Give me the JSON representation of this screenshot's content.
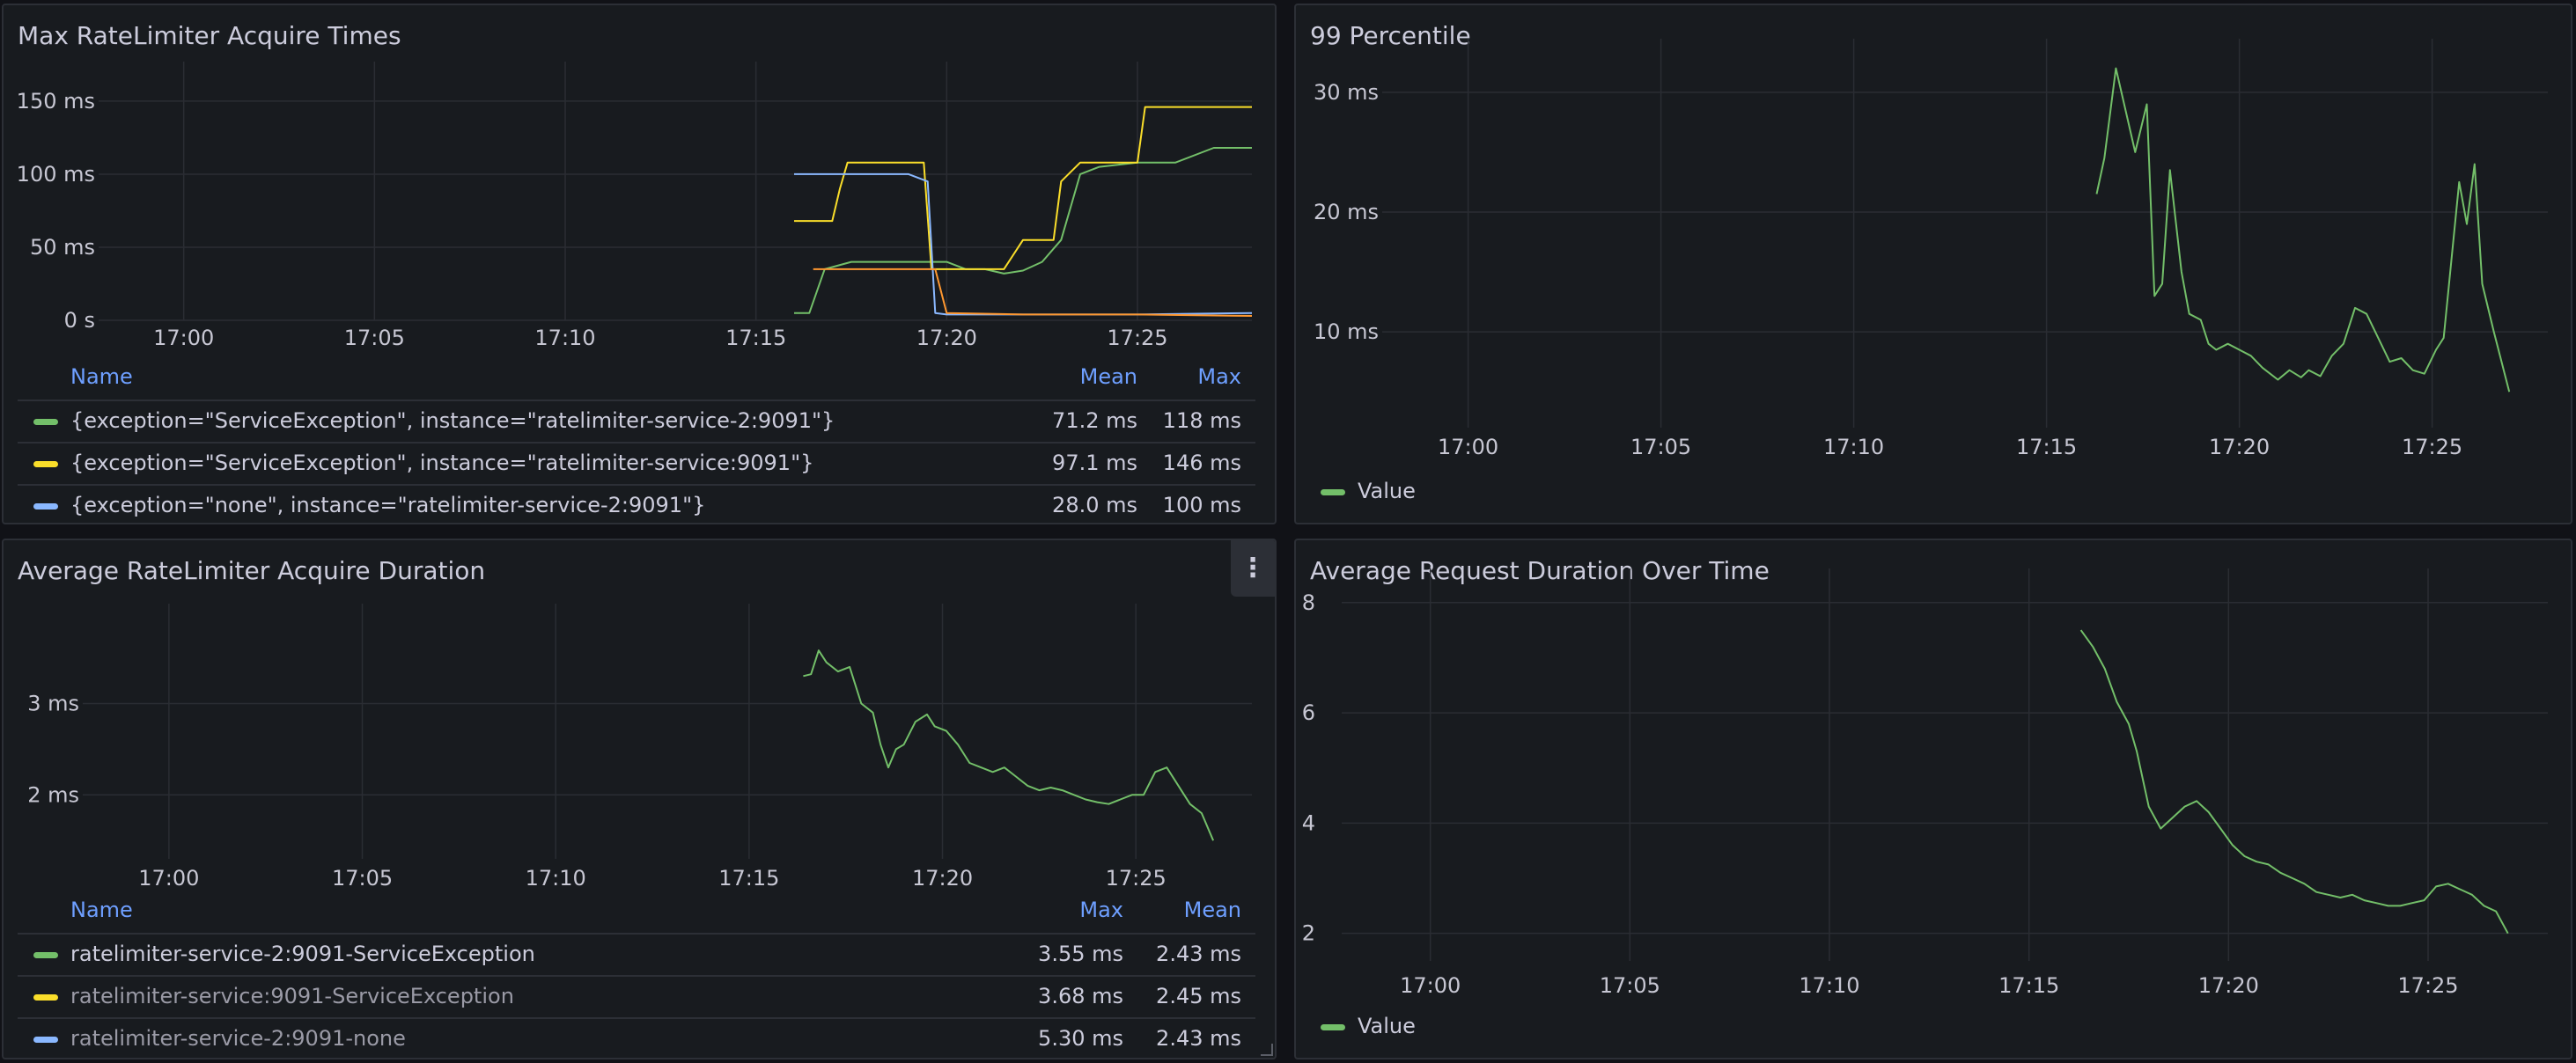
{
  "colors": {
    "green": "#73bf69",
    "yellow": "#fade2a",
    "blue": "#8ab8ff",
    "orange": "#ff9830"
  },
  "panels": {
    "max_acquire": {
      "title": "Max RateLimiter Acquire Times",
      "legend": {
        "headers": [
          "Name",
          "Mean",
          "Max"
        ],
        "rows": [
          {
            "name": "{exception=\"ServiceException\", instance=\"ratelimiter-service-2:9091\"}",
            "mean": "71.2 ms",
            "max": "118 ms",
            "color": "#73bf69"
          },
          {
            "name": "{exception=\"ServiceException\", instance=\"ratelimiter-service:9091\"}",
            "mean": "97.1 ms",
            "max": "146 ms",
            "color": "#fade2a"
          },
          {
            "name": "{exception=\"none\", instance=\"ratelimiter-service-2:9091\"}",
            "mean": "28.0 ms",
            "max": "100 ms",
            "color": "#8ab8ff"
          }
        ]
      }
    },
    "p99": {
      "title": "99 Percentile",
      "legend": {
        "label": "Value",
        "color": "#73bf69"
      }
    },
    "avg_acquire": {
      "title": "Average RateLimiter Acquire Duration",
      "menu_icon": "⋮",
      "legend": {
        "headers": [
          "Name",
          "Max",
          "Mean"
        ],
        "rows": [
          {
            "name": "ratelimiter-service-2:9091-ServiceException",
            "max": "3.55 ms",
            "mean": "2.43 ms",
            "color": "#73bf69"
          },
          {
            "name": "ratelimiter-service:9091-ServiceException",
            "max": "3.68 ms",
            "mean": "2.45 ms",
            "color": "#fade2a"
          },
          {
            "name": "ratelimiter-service-2:9091-none",
            "max": "5.30 ms",
            "mean": "2.43 ms",
            "color": "#8ab8ff"
          }
        ]
      }
    },
    "avg_request": {
      "title": "Average Request Duration Over Time",
      "legend": {
        "label": "Value",
        "color": "#73bf69"
      }
    }
  },
  "chart_data": [
    {
      "type": "line",
      "title": "Max RateLimiter Acquire Times",
      "x_ticks": [
        "17:00",
        "17:05",
        "17:10",
        "17:15",
        "17:20",
        "17:25"
      ],
      "y_ticks": [
        "0 s",
        "50 ms",
        "100 ms",
        "150 ms"
      ],
      "x_range": [
        "16:58",
        "17:28"
      ],
      "ylim": [
        0,
        165
      ],
      "grid": true,
      "series": [
        {
          "color": "#73bf69",
          "x": [
            "17:16",
            "17:16.4",
            "17:16.8",
            "17:17.5",
            "17:18",
            "17:19",
            "17:19.5",
            "17:20",
            "17:20.5",
            "17:21",
            "17:21.5",
            "17:22",
            "17:22.5",
            "17:23",
            "17:23.5",
            "17:24",
            "17:25",
            "17:26",
            "17:27",
            "17:28"
          ],
          "y": [
            5,
            5,
            35,
            40,
            40,
            40,
            40,
            40,
            35,
            35,
            32,
            34,
            40,
            55,
            100,
            105,
            108,
            108,
            118,
            118
          ]
        },
        {
          "color": "#fade2a",
          "x": [
            "17:16",
            "17:17",
            "17:17.2",
            "17:17.4",
            "17:18.5",
            "17:19.4",
            "17:19.6",
            "17:20.5",
            "17:21",
            "17:21.5",
            "17:22",
            "17:22.8",
            "17:23",
            "17:23.5",
            "17:24",
            "17:25",
            "17:25.2",
            "17:26",
            "17:28"
          ],
          "y": [
            68,
            68,
            90,
            108,
            108,
            108,
            35,
            35,
            35,
            35,
            55,
            55,
            95,
            108,
            108,
            108,
            146,
            146,
            146
          ]
        },
        {
          "color": "#8ab8ff",
          "x": [
            "17:16",
            "17:18",
            "17:19",
            "17:19.5",
            "17:19.7",
            "17:20",
            "17:22",
            "17:25",
            "17:28"
          ],
          "y": [
            100,
            100,
            100,
            95,
            5,
            4,
            4,
            4,
            5
          ]
        },
        {
          "color": "#ff9830",
          "x": [
            "17:16.5",
            "17:18",
            "17:19.7",
            "17:20",
            "17:22",
            "17:25",
            "17:28"
          ],
          "y": [
            35,
            35,
            35,
            5,
            4,
            4,
            3
          ]
        }
      ]
    },
    {
      "type": "line",
      "title": "99 Percentile",
      "x_ticks": [
        "17:00",
        "17:05",
        "17:10",
        "17:15",
        "17:20",
        "17:25"
      ],
      "y_ticks": [
        "10 ms",
        "20 ms",
        "30 ms"
      ],
      "x_range": [
        "16:58",
        "17:28"
      ],
      "ylim": [
        2,
        33
      ],
      "grid": true,
      "series": [
        {
          "name": "Value",
          "color": "#73bf69",
          "x": [
            "17:16.3",
            "17:16.5",
            "17:16.8",
            "17:17.3",
            "17:17.6",
            "17:17.8",
            "17:18.0",
            "17:18.2",
            "17:18.5",
            "17:18.7",
            "17:19.0",
            "17:19.2",
            "17:19.4",
            "17:19.7",
            "17:20.0",
            "17:20.3",
            "17:20.6",
            "17:20.8",
            "17:21.0",
            "17:21.3",
            "17:21.6",
            "17:21.8",
            "17:22.1",
            "17:22.4",
            "17:22.7",
            "17:23.0",
            "17:23.3",
            "17:23.6",
            "17:23.9",
            "17:24.2",
            "17:24.5",
            "17:24.8",
            "17:25.1",
            "17:25.3",
            "17:25.5",
            "17:25.7",
            "17:25.9",
            "17:26.1",
            "17:26.3",
            "17:26.6",
            "17:27"
          ],
          "y": [
            21.5,
            24.5,
            32,
            25,
            29,
            13,
            14,
            23.5,
            15,
            11.5,
            11,
            9,
            8.5,
            9,
            8.5,
            8,
            7,
            6.5,
            6,
            6.8,
            6.2,
            6.8,
            6.3,
            8,
            9,
            12,
            11.5,
            9.5,
            7.5,
            7.8,
            6.8,
            6.5,
            8.5,
            9.5,
            16,
            22.5,
            19,
            24,
            14,
            10,
            5
          ]
        }
      ]
    },
    {
      "type": "line",
      "title": "Average RateLimiter Acquire Duration",
      "x_ticks": [
        "17:00",
        "17:05",
        "17:10",
        "17:15",
        "17:20",
        "17:25"
      ],
      "y_ticks": [
        "2 ms",
        "3 ms"
      ],
      "x_range": [
        "16:58",
        "17:28"
      ],
      "ylim": [
        1.3,
        3.9
      ],
      "grid": true,
      "series": [
        {
          "color": "#73bf69",
          "x": [
            "17:16.4",
            "17:16.6",
            "17:16.8",
            "17:17.0",
            "17:17.3",
            "17:17.6",
            "17:17.9",
            "17:18.2",
            "17:18.4",
            "17:18.6",
            "17:18.8",
            "17:19.0",
            "17:19.3",
            "17:19.6",
            "17:19.8",
            "17:20.1",
            "17:20.4",
            "17:20.7",
            "17:21.0",
            "17:21.3",
            "17:21.6",
            "17:21.9",
            "17:22.2",
            "17:22.5",
            "17:22.8",
            "17:23.1",
            "17:23.4",
            "17:23.7",
            "17:24.0",
            "17:24.3",
            "17:24.6",
            "17:24.9",
            "17:25.2",
            "17:25.5",
            "17:25.8",
            "17:26.1",
            "17:26.4",
            "17:26.7",
            "17:27"
          ],
          "y": [
            3.3,
            3.32,
            3.58,
            3.45,
            3.35,
            3.4,
            3.0,
            2.9,
            2.55,
            2.3,
            2.5,
            2.55,
            2.8,
            2.88,
            2.75,
            2.7,
            2.55,
            2.35,
            2.3,
            2.25,
            2.3,
            2.2,
            2.1,
            2.05,
            2.08,
            2.05,
            2.0,
            1.95,
            1.92,
            1.9,
            1.95,
            2.0,
            2.0,
            2.25,
            2.3,
            2.1,
            1.9,
            1.8,
            1.5
          ]
        }
      ]
    },
    {
      "type": "line",
      "title": "Average Request Duration Over Time",
      "x_ticks": [
        "17:00",
        "17:05",
        "17:10",
        "17:15",
        "17:20",
        "17:25"
      ],
      "y_ticks": [
        "2",
        "4",
        "6",
        "8"
      ],
      "x_range": [
        "16:58",
        "17:28"
      ],
      "ylim": [
        1.5,
        8.3
      ],
      "grid": true,
      "series": [
        {
          "name": "Value",
          "color": "#73bf69",
          "x": [
            "17:16.3",
            "17:16.6",
            "17:16.9",
            "17:17.2",
            "17:17.5",
            "17:17.7",
            "17:18.0",
            "17:18.3",
            "17:18.6",
            "17:18.9",
            "17:19.2",
            "17:19.5",
            "17:19.8",
            "17:20.1",
            "17:20.4",
            "17:20.7",
            "17:21.0",
            "17:21.3",
            "17:21.6",
            "17:21.9",
            "17:22.2",
            "17:22.5",
            "17:22.8",
            "17:23.1",
            "17:23.4",
            "17:23.7",
            "17:24.0",
            "17:24.3",
            "17:24.6",
            "17:24.9",
            "17:25.2",
            "17:25.5",
            "17:25.8",
            "17:26.1",
            "17:26.4",
            "17:26.7",
            "17:27"
          ],
          "y": [
            7.5,
            7.2,
            6.8,
            6.2,
            5.8,
            5.3,
            4.3,
            3.9,
            4.1,
            4.3,
            4.4,
            4.2,
            3.9,
            3.6,
            3.4,
            3.3,
            3.25,
            3.1,
            3.0,
            2.9,
            2.75,
            2.7,
            2.65,
            2.7,
            2.6,
            2.55,
            2.5,
            2.5,
            2.55,
            2.6,
            2.85,
            2.9,
            2.8,
            2.7,
            2.5,
            2.4,
            2.0
          ]
        }
      ]
    }
  ]
}
